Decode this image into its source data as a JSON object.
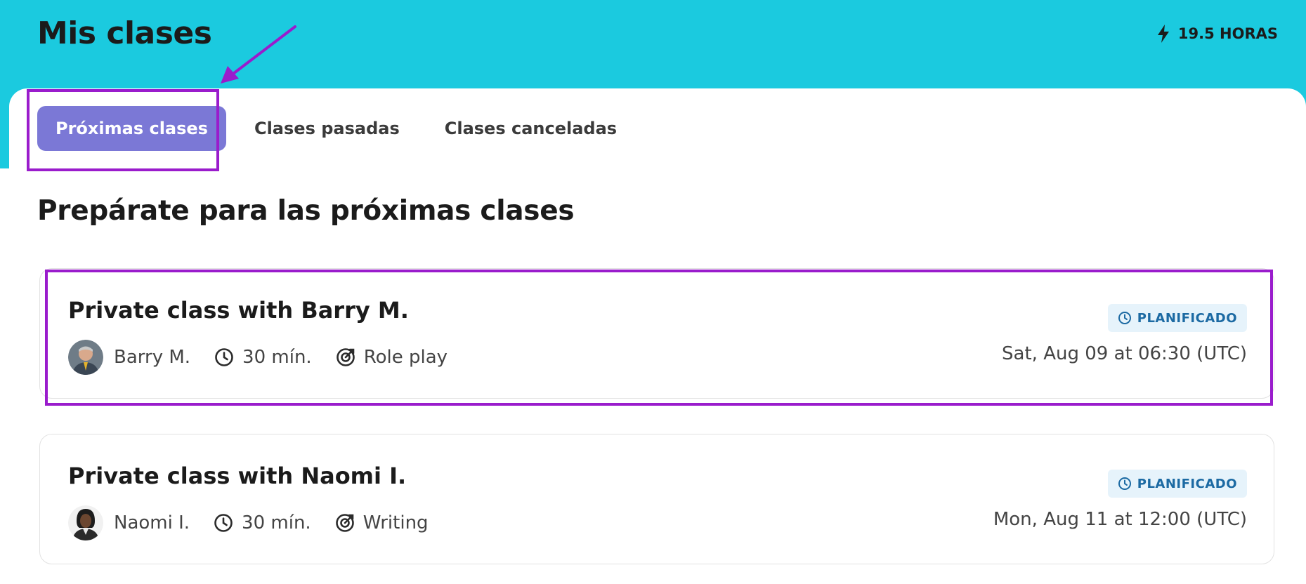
{
  "header": {
    "title": "Mis clases",
    "hours_label": "19.5 HORAS"
  },
  "tabs": [
    {
      "label": "Próximas clases",
      "active": true
    },
    {
      "label": "Clases pasadas",
      "active": false
    },
    {
      "label": "Clases canceladas",
      "active": false
    }
  ],
  "section": {
    "title": "Prepárate para las próximas clases"
  },
  "classes": [
    {
      "title": "Private class with Barry M.",
      "teacher": "Barry M.",
      "duration": "30 mín.",
      "topic": "Role play",
      "status": "PLANIFICADO",
      "datetime": "Sat, Aug 09 at 06:30 (UTC)"
    },
    {
      "title": "Private class with Naomi I.",
      "teacher": "Naomi I.",
      "duration": "30 mín.",
      "topic": "Writing",
      "status": "PLANIFICADO",
      "datetime": "Mon, Aug 11 at 12:00 (UTC)"
    }
  ],
  "colors": {
    "header_bg": "#1bcadf",
    "active_tab": "#7b78d6",
    "badge_bg": "#e6f3fb",
    "badge_text": "#1c6aa3",
    "annotation": "#9a1ccc"
  },
  "icons": {
    "hours": "lightning-icon",
    "duration": "clock-icon",
    "topic": "target-icon",
    "status": "clock-icon"
  }
}
